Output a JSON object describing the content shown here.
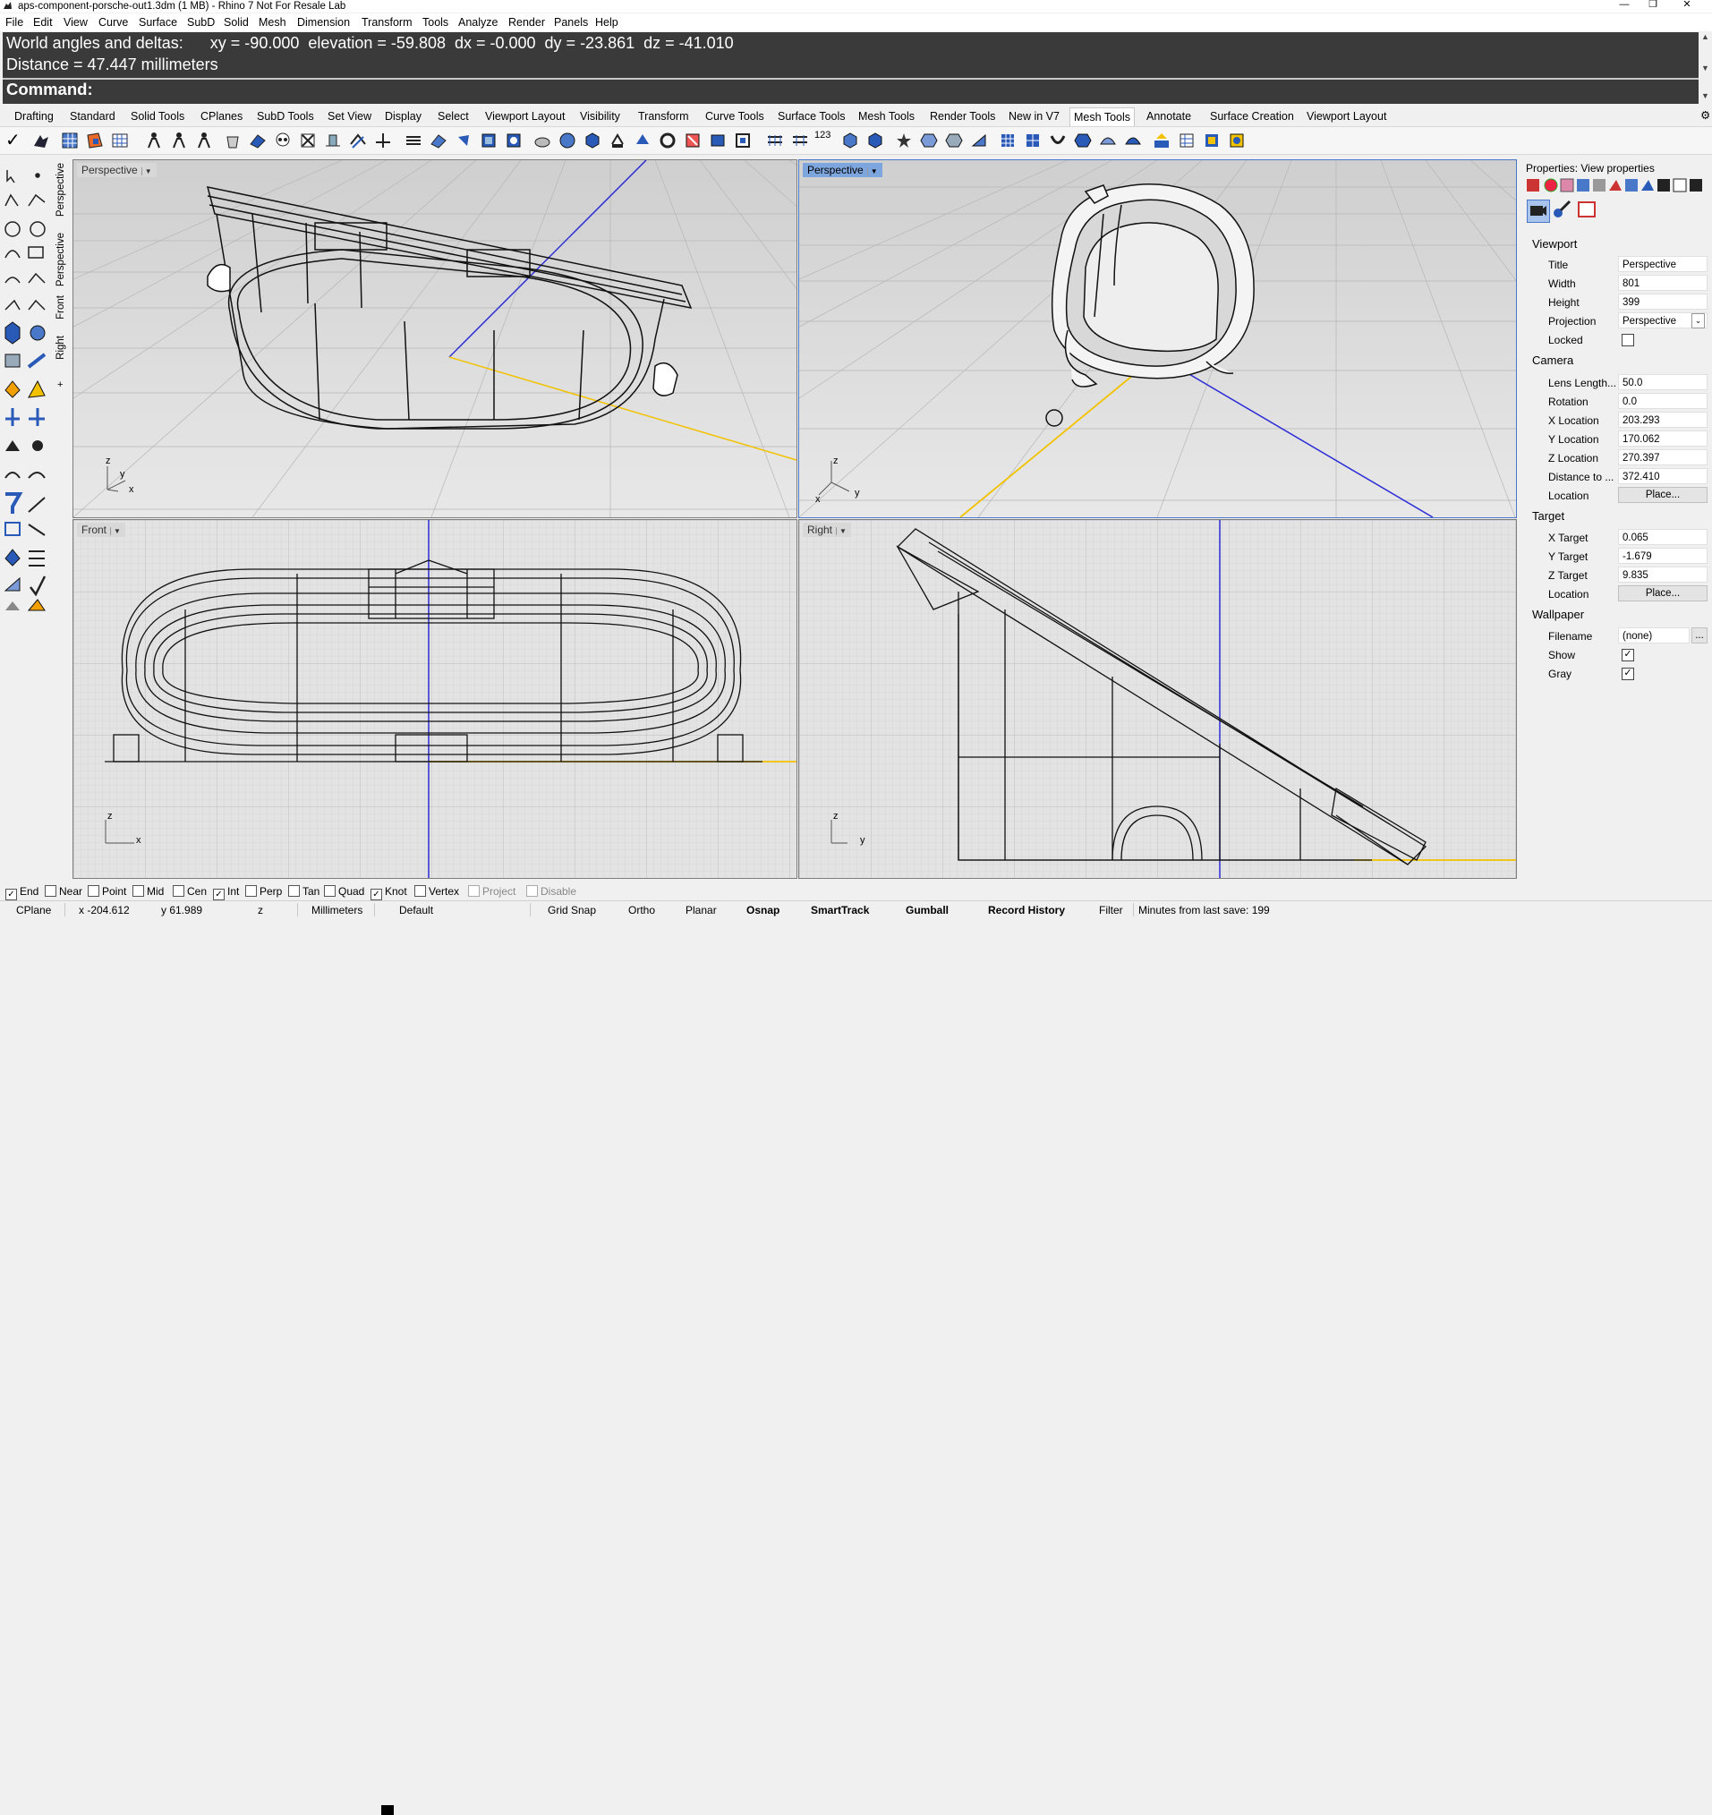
{
  "window": {
    "title": "aps-component-porsche-out1.3dm (1 MB) - Rhino 7 Not For Resale Lab"
  },
  "menu": [
    "File",
    "Edit",
    "View",
    "Curve",
    "Surface",
    "SubD",
    "Solid",
    "Mesh",
    "Dimension",
    "Transform",
    "Tools",
    "Analyze",
    "Render",
    "Panels",
    "Help"
  ],
  "command": {
    "line1": "World angles and deltas:      xy = -90.000  elevation = -59.808  dx = -0.000  dy = -23.861  dz = -41.010",
    "line2": "Distance = 47.447 millimeters",
    "prompt": "Command:"
  },
  "tabs": [
    "Drafting",
    "Standard",
    "Solid Tools",
    "CPlanes",
    "SubD Tools",
    "Set View",
    "Display",
    "Select",
    "Viewport Layout",
    "Visibility",
    "Transform",
    "Curve Tools",
    "Surface Tools",
    "Mesh Tools",
    "Render Tools",
    "New in V7",
    "Mesh Tools",
    "Annotate",
    "Surface Creation",
    "Viewport Layout"
  ],
  "active_tab": "Mesh Tools",
  "side_tabs": [
    "Perspective",
    "Perspective",
    "Front",
    "Right"
  ],
  "viewports": {
    "top_left": "Perspective",
    "top_right": "Perspective",
    "bottom_left": "Front",
    "bottom_right": "Right"
  },
  "axis": {
    "x": "x",
    "y": "y",
    "z": "z"
  },
  "properties": {
    "header": "Properties: View properties",
    "viewport_section": "Viewport",
    "title_label": "Title",
    "title_value": "Perspective",
    "width_label": "Width",
    "width_value": "801",
    "height_label": "Height",
    "height_value": "399",
    "projection_label": "Projection",
    "projection_value": "Perspective",
    "locked_label": "Locked",
    "locked": false,
    "camera_section": "Camera",
    "lens_label": "Lens Length...",
    "lens_value": "50.0",
    "rotation_label": "Rotation",
    "rotation_value": "0.0",
    "xloc_label": "X Location",
    "xloc_value": "203.293",
    "yloc_label": "Y Location",
    "yloc_value": "170.062",
    "zloc_label": "Z Location",
    "zloc_value": "270.397",
    "dist_label": "Distance to ...",
    "dist_value": "372.410",
    "location_label": "Location",
    "place_button": "Place...",
    "target_section": "Target",
    "xt_label": "X Target",
    "xt_value": "0.065",
    "yt_label": "Y Target",
    "yt_value": "-1.679",
    "zt_label": "Z Target",
    "zt_value": "9.835",
    "tloc_label": "Location",
    "wallpaper_section": "Wallpaper",
    "filename_label": "Filename",
    "filename_value": "(none)",
    "browse_button": "...",
    "show_label": "Show",
    "show": true,
    "gray_label": "Gray",
    "gray": true
  },
  "osnap": [
    {
      "label": "End",
      "checked": true,
      "enabled": true
    },
    {
      "label": "Near",
      "checked": false,
      "enabled": true
    },
    {
      "label": "Point",
      "checked": false,
      "enabled": true
    },
    {
      "label": "Mid",
      "checked": false,
      "enabled": true
    },
    {
      "label": "Cen",
      "checked": false,
      "enabled": true
    },
    {
      "label": "Int",
      "checked": true,
      "enabled": true
    },
    {
      "label": "Perp",
      "checked": false,
      "enabled": true
    },
    {
      "label": "Tan",
      "checked": false,
      "enabled": true
    },
    {
      "label": "Quad",
      "checked": false,
      "enabled": true
    },
    {
      "label": "Knot",
      "checked": true,
      "enabled": true
    },
    {
      "label": "Vertex",
      "checked": false,
      "enabled": true
    },
    {
      "label": "Project",
      "checked": false,
      "enabled": false
    },
    {
      "label": "Disable",
      "checked": false,
      "enabled": false
    }
  ],
  "status": {
    "cplane": "CPlane",
    "x": "x -204.612",
    "y": "y 61.989",
    "z": "z",
    "units": "Millimeters",
    "layer": "Default",
    "grid_snap": "Grid Snap",
    "ortho": "Ortho",
    "planar": "Planar",
    "osnap": "Osnap",
    "smarttrack": "SmartTrack",
    "gumball": "Gumball",
    "record_history": "Record History",
    "filter": "Filter",
    "last_save": "Minutes from last save: 199"
  },
  "colors": {
    "cmd_bg": "#3a3a3a",
    "viewport_bg": "#d6d6d6",
    "active_label": "#7ea6de",
    "axis_x": "#f2c200",
    "axis_y": "#2b2bd6"
  }
}
